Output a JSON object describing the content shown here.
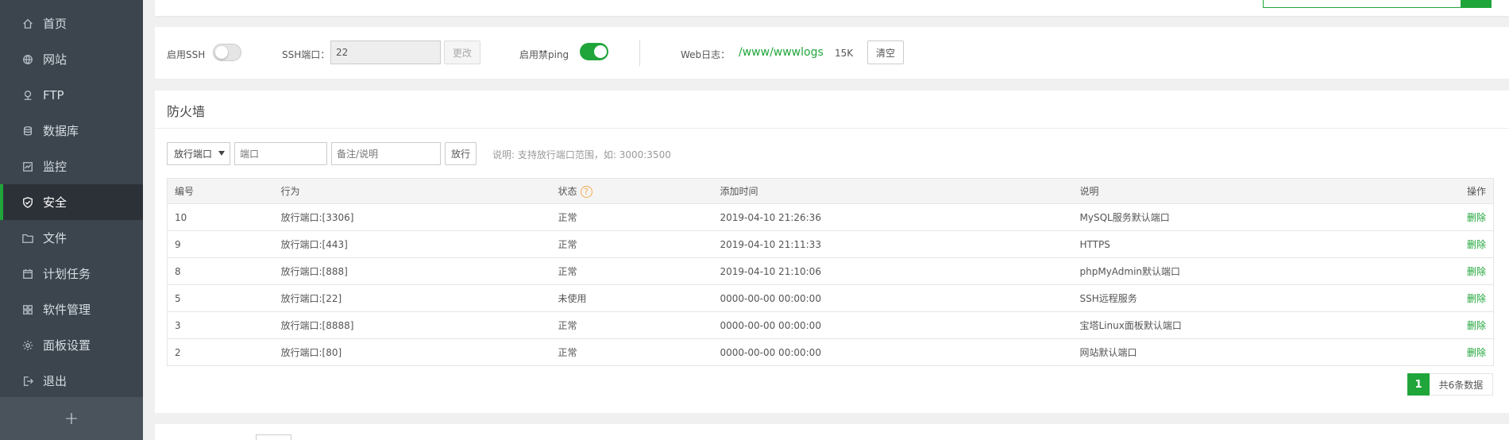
{
  "sidebar": {
    "items": [
      {
        "label": "首页",
        "icon": "home-icon"
      },
      {
        "label": "网站",
        "icon": "globe-icon"
      },
      {
        "label": "FTP",
        "icon": "ftp-icon"
      },
      {
        "label": "数据库",
        "icon": "database-icon"
      },
      {
        "label": "监控",
        "icon": "monitor-icon"
      },
      {
        "label": "安全",
        "icon": "shield-icon",
        "active": true
      },
      {
        "label": "文件",
        "icon": "folder-icon"
      },
      {
        "label": "计划任务",
        "icon": "calendar-icon"
      },
      {
        "label": "软件管理",
        "icon": "grid-icon"
      },
      {
        "label": "面板设置",
        "icon": "gear-icon"
      },
      {
        "label": "退出",
        "icon": "logout-icon"
      }
    ],
    "add_label": "+"
  },
  "ssh": {
    "ssh_label": "启用SSH",
    "ssh_enabled": false,
    "port_label": "SSH端口：",
    "port_value": "22",
    "change_label": "更改",
    "ping_label": "启用禁ping",
    "ping_enabled": true,
    "weblog_label": "Web日志：",
    "weblog_path": "/www/wwwlogs",
    "weblog_size": "15K",
    "clear_label": "清空"
  },
  "firewall": {
    "title": "防火墙",
    "select_value": "放行端口",
    "port_placeholder": "端口",
    "note_placeholder": "备注/说明",
    "allow_label": "放行",
    "hint": "说明: 支持放行端口范围，如: 3000:3500",
    "columns": [
      "编号",
      "行为",
      "状态",
      "添加时间",
      "说明",
      "操作"
    ],
    "help_mark": "?",
    "rows": [
      {
        "id": "10",
        "action": "放行端口:[3306]",
        "status": "正常",
        "time": "2019-04-10 21:26:36",
        "note": "MySQL服务默认端口",
        "op": "删除"
      },
      {
        "id": "9",
        "action": "放行端口:[443]",
        "status": "正常",
        "time": "2019-04-10 21:11:33",
        "note": "HTTPS",
        "op": "删除"
      },
      {
        "id": "8",
        "action": "放行端口:[888]",
        "status": "正常",
        "time": "2019-04-10 21:10:06",
        "note": "phpMyAdmin默认端口",
        "op": "删除"
      },
      {
        "id": "5",
        "action": "放行端口:[22]",
        "status": "未使用",
        "time": "0000-00-00 00:00:00",
        "note": "SSH远程服务",
        "op": "删除"
      },
      {
        "id": "3",
        "action": "放行端口:[8888]",
        "status": "正常",
        "time": "0000-00-00 00:00:00",
        "note": "宝塔Linux面板默认端口",
        "op": "删除"
      },
      {
        "id": "2",
        "action": "放行端口:[80]",
        "status": "正常",
        "time": "0000-00-00 00:00:00",
        "note": "网站默认端口",
        "op": "删除"
      }
    ],
    "pagination": {
      "current": "1",
      "total_text": "共6条数据"
    }
  },
  "colors": {
    "accent": "#20a53a",
    "sidebar_bg": "#3c444d",
    "help": "#f0ad4e"
  }
}
